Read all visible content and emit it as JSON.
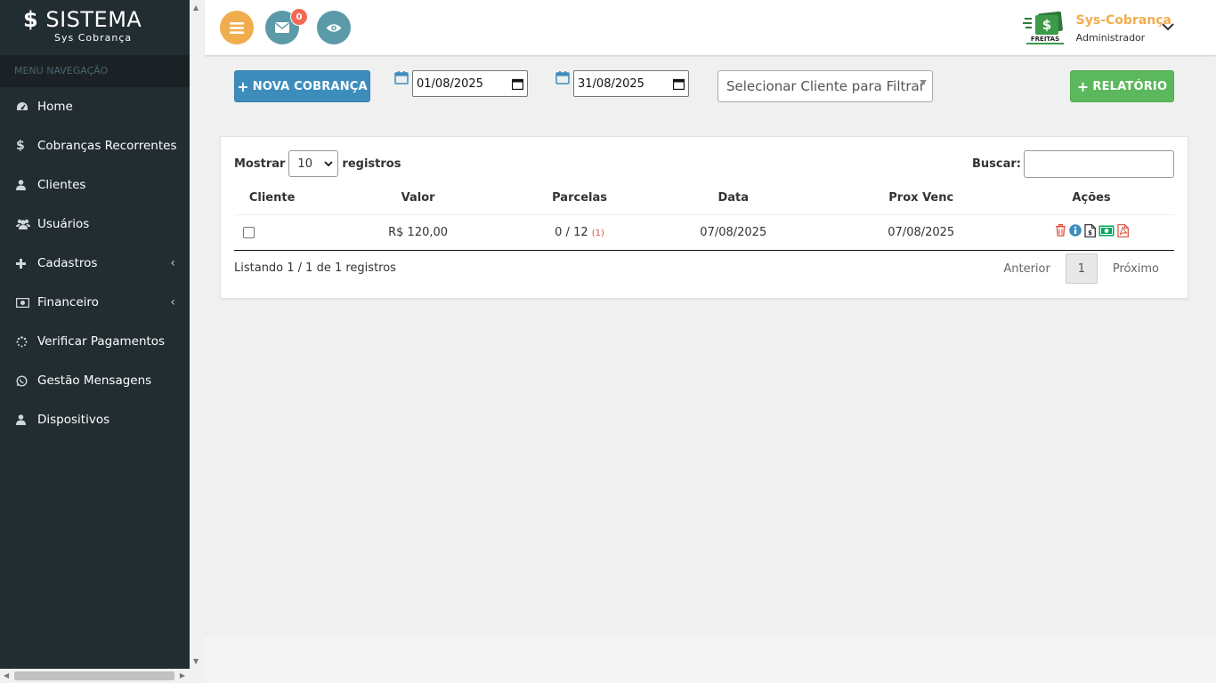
{
  "sidebar": {
    "brand_symbol": "$",
    "brand_title": "SISTEMA",
    "brand_subtitle": "Sys Cobrança",
    "menu_header": "MENU NAVEGAÇÃO",
    "items": [
      {
        "label": "Home",
        "icon": "dashboard-icon"
      },
      {
        "label": "Cobranças Recorrentes",
        "icon": "dollar-icon"
      },
      {
        "label": "Clientes",
        "icon": "user-icon"
      },
      {
        "label": "Usuários",
        "icon": "users-icon"
      },
      {
        "label": "Cadastros",
        "icon": "plus-icon",
        "caret": "‹"
      },
      {
        "label": "Financeiro",
        "icon": "money-icon",
        "caret": "‹"
      },
      {
        "label": "Verificar Pagamentos",
        "icon": "spinner-icon"
      },
      {
        "label": "Gestão Mensagens",
        "icon": "whatsapp-icon"
      },
      {
        "label": "Dispositivos",
        "icon": "user-icon"
      }
    ]
  },
  "topbar": {
    "mail_badge": "0",
    "user_name": "Sys-Cobrança",
    "user_role": "Administrador",
    "logo_text": "FREITAS"
  },
  "toolbar": {
    "new_button": "NOVA COBRANÇA",
    "date_start": "01/08/2025",
    "date_end": "31/08/2025",
    "client_filter_placeholder": "Selecionar Cliente para Filtrar",
    "report_button": "RELATÓRIO"
  },
  "table": {
    "length_label_before": "Mostrar",
    "length_value": "10",
    "length_label_after": "registros",
    "search_label": "Buscar:",
    "columns": [
      "Cliente",
      "Valor",
      "Parcelas",
      "Data",
      "Prox Venc",
      "Ações"
    ],
    "rows": [
      {
        "valor": "R$ 120,00",
        "parcelas": "0 / 12",
        "parcelas_late": "(1)",
        "data": "07/08/2025",
        "prox_venc": "07/08/2025"
      }
    ],
    "info": "Listando 1 / 1 de 1 registros",
    "pager": {
      "prev": "Anterior",
      "current": "1",
      "next": "Próximo"
    }
  },
  "colors": {
    "sidebar_bg": "#222d32",
    "primary": "#3c8dbc",
    "success": "#5cb85c",
    "warning": "#f0ad4e",
    "danger": "#dd4b39",
    "teal": "#5b9aa8"
  }
}
